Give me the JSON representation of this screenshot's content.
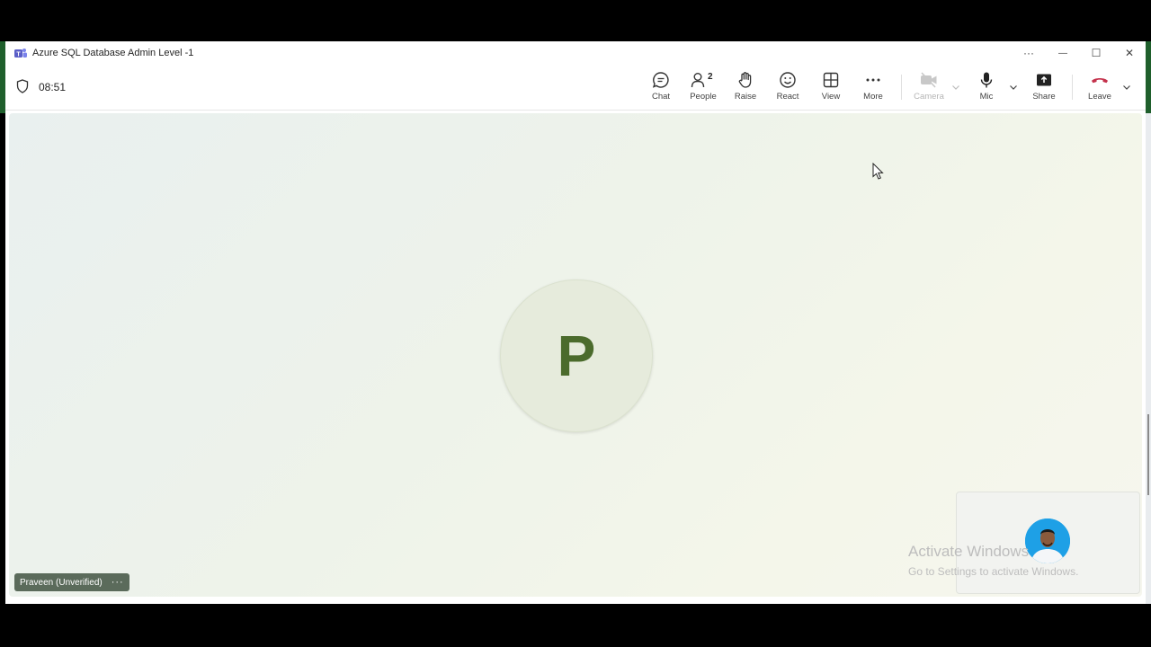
{
  "window": {
    "title": "Azure SQL Database Admin Level -1",
    "controls": {
      "more": "···",
      "minimize": "—",
      "maximize": "☐",
      "close": "✕"
    }
  },
  "meeting": {
    "timer": "08:51",
    "toolbar": [
      {
        "id": "chat",
        "label": "Chat",
        "icon": "chat-icon"
      },
      {
        "id": "people",
        "label": "People",
        "icon": "people-icon",
        "count": "2"
      },
      {
        "id": "raise",
        "label": "Raise",
        "icon": "hand-icon"
      },
      {
        "id": "react",
        "label": "React",
        "icon": "smile-icon"
      },
      {
        "id": "view",
        "label": "View",
        "icon": "grid-icon"
      },
      {
        "id": "more",
        "label": "More",
        "icon": "ellipsis-icon"
      },
      {
        "id": "camera",
        "label": "Camera",
        "icon": "camera-off-icon",
        "disabled": true
      },
      {
        "id": "mic",
        "label": "Mic",
        "icon": "mic-icon"
      },
      {
        "id": "share",
        "label": "Share",
        "icon": "share-icon"
      },
      {
        "id": "leave",
        "label": "Leave",
        "icon": "hangup-icon"
      }
    ],
    "participant": {
      "initial": "P",
      "name_tag": "Praveen (Unverified)",
      "name_tag_more": "···"
    }
  },
  "watermark": {
    "line1": "Activate Windows",
    "line2": "Go to Settings to activate Windows."
  },
  "colors": {
    "accent": "#5b5fc7",
    "leave": "#c4314b",
    "avatar_text": "#4b6b2c"
  }
}
